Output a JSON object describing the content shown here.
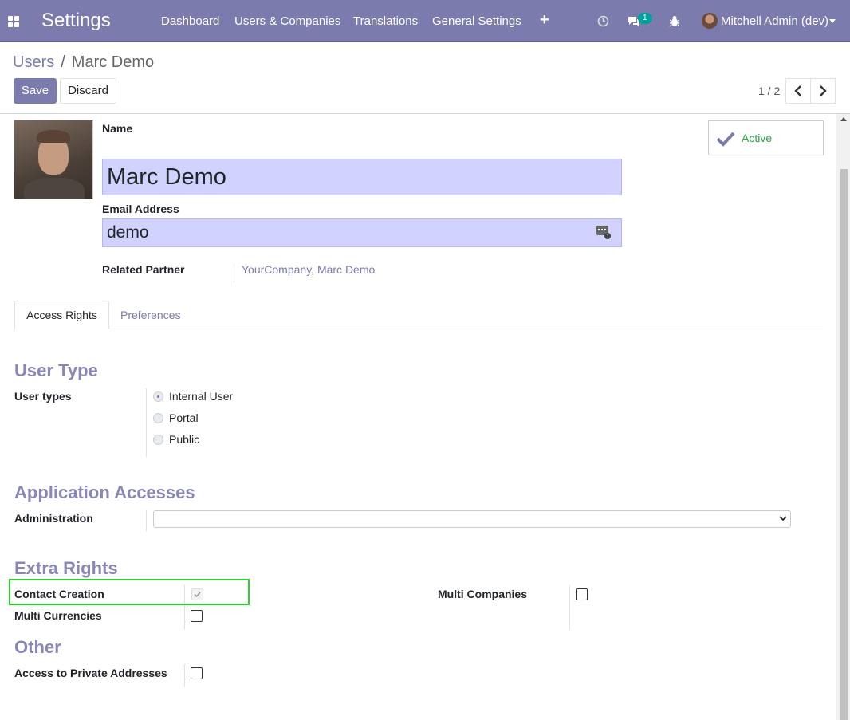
{
  "navbar": {
    "app_name": "Settings",
    "menu": [
      "Dashboard",
      "Users & Companies",
      "Translations",
      "General Settings"
    ],
    "new_icon": "plus-icon",
    "messages_badge": "1",
    "user": "Mitchell Admin (dev)"
  },
  "breadcrumb": {
    "parent": "Users",
    "separator": "/",
    "current": "Marc Demo"
  },
  "buttons": {
    "save": "Save",
    "discard": "Discard"
  },
  "pager": {
    "value": "1 / 2"
  },
  "form": {
    "name_label": "Name",
    "name_value": "Marc Demo",
    "email_label": "Email Address",
    "email_value": "demo",
    "partner_label": "Related Partner",
    "partner_value": "YourCompany, Marc Demo",
    "active_label": "Active"
  },
  "tabs": [
    "Access Rights",
    "Preferences"
  ],
  "user_type": {
    "title": "User Type",
    "label": "User types",
    "options": [
      "Internal User",
      "Portal",
      "Public"
    ],
    "selected": "Internal User"
  },
  "app_access": {
    "title": "Application Accesses",
    "administration_label": "Administration",
    "administration_value": ""
  },
  "extra_rights": {
    "title": "Extra Rights",
    "contact_creation": "Contact Creation",
    "multi_currencies": "Multi Currencies",
    "multi_companies": "Multi Companies"
  },
  "other": {
    "title": "Other",
    "private_addresses": "Access to Private Addresses"
  },
  "colors": {
    "brand": "#7c7bad",
    "active": "#28a745",
    "highlight": "#2ecc2e"
  }
}
